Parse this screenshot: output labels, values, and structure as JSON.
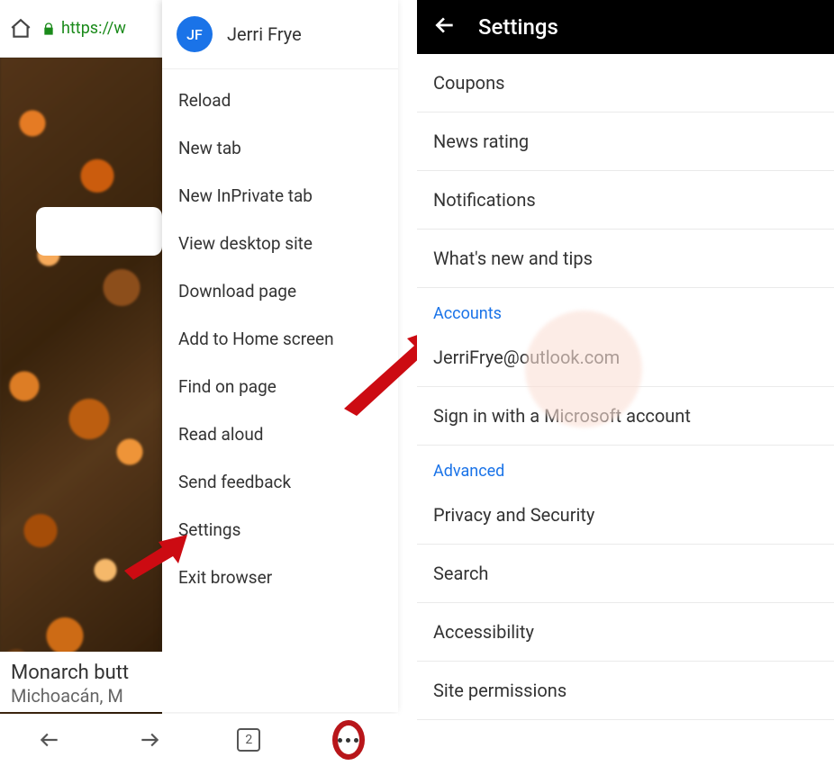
{
  "left": {
    "url_prefix": "https://w",
    "user": {
      "initials": "JF",
      "name": "Jerri Frye"
    },
    "menu": [
      "Reload",
      "New tab",
      "New InPrivate tab",
      "View desktop site",
      "Download page",
      "Add to Home screen",
      "Find on page",
      "Read aloud",
      "Send feedback",
      "Settings",
      "Exit browser"
    ],
    "caption_title": "Monarch butt",
    "caption_sub": "Michoacán, M",
    "tab_count": "2"
  },
  "right": {
    "header_title": "Settings",
    "items": [
      "Coupons",
      "News rating",
      "Notifications",
      "What's new and tips"
    ],
    "section_accounts": "Accounts",
    "account_email": "JerriFrye@outlook.com",
    "sign_in_label": "Sign in with a Microsoft account",
    "section_advanced": "Advanced",
    "advanced_items": [
      "Privacy and Security",
      "Search",
      "Accessibility",
      "Site permissions"
    ]
  }
}
